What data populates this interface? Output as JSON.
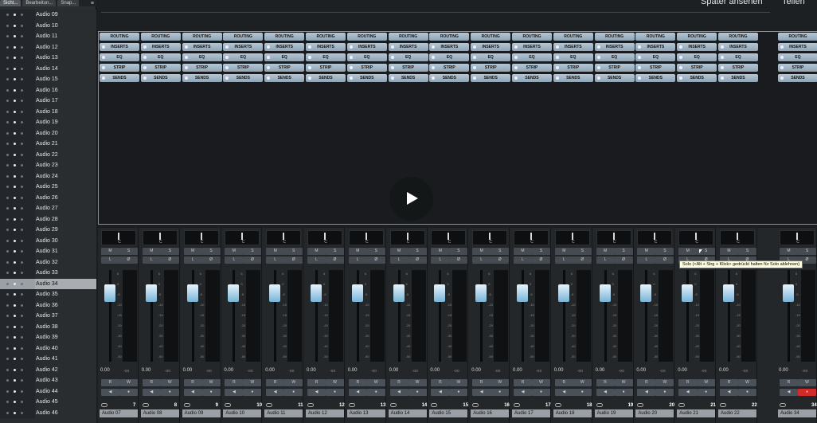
{
  "left_panel": {
    "tabs": [
      "Sicht...",
      "Bearbeitun...",
      "Snap..."
    ],
    "menu_icon": "menu-icon",
    "tracks": [
      "Audio 09",
      "Audio 10",
      "Audio 11",
      "Audio 12",
      "Audio 13",
      "Audio 14",
      "Audio 15",
      "Audio 16",
      "Audio 17",
      "Audio 18",
      "Audio 19",
      "Audio 20",
      "Audio 21",
      "Audio 22",
      "Audio 23",
      "Audio 24",
      "Audio 25",
      "Audio 26",
      "Audio 27",
      "Audio 28",
      "Audio 29",
      "Audio 30",
      "Audio 31",
      "Audio 32",
      "Audio 33",
      "Audio 34",
      "Audio 35",
      "Audio 36",
      "Audio 37",
      "Audio 38",
      "Audio 39",
      "Audio 40",
      "Audio 41",
      "Audio 42",
      "Audio 43",
      "Audio 44",
      "Audio 45",
      "Audio 46"
    ],
    "selected_track": "Audio 34"
  },
  "top_bar": {
    "watch_later": "Später ansehen",
    "share": "Teilen"
  },
  "rack_buttons": [
    "ROUTING",
    "INSERTS",
    "EQ",
    "STRIP",
    "SENDS"
  ],
  "play_icon": "play-icon",
  "strips": [
    {
      "num": "7",
      "name": "Audio 07"
    },
    {
      "num": "8",
      "name": "Audio 08"
    },
    {
      "num": "9",
      "name": "Audio 09"
    },
    {
      "num": "10",
      "name": "Audio 10"
    },
    {
      "num": "11",
      "name": "Audio 11"
    },
    {
      "num": "12",
      "name": "Audio 12"
    },
    {
      "num": "13",
      "name": "Audio 13"
    },
    {
      "num": "14",
      "name": "Audio 14"
    },
    {
      "num": "15",
      "name": "Audio 15"
    },
    {
      "num": "16",
      "name": "Audio 16"
    },
    {
      "num": "17",
      "name": "Audio 17"
    },
    {
      "num": "18",
      "name": "Audio 18"
    },
    {
      "num": "19",
      "name": "Audio 19"
    },
    {
      "num": "20",
      "name": "Audio 20"
    },
    {
      "num": "21",
      "name": "Audio 21"
    },
    {
      "num": "22",
      "name": "Audio 22"
    },
    {
      "num": "34",
      "name": "Audio 34"
    }
  ],
  "strip_controls": {
    "pan": "C",
    "mute": "M",
    "solo": "S",
    "listen": "L",
    "phase": "Ø",
    "read": "R",
    "write": "W",
    "volume": "0.00",
    "peak": "-oo",
    "scale": [
      "6",
      "0",
      "-5",
      "-10",
      "-15",
      "-20",
      "-30",
      "-40",
      "-50"
    ]
  },
  "tooltip": "Solo (<Alt + Strg + Klick> gedrückt halten für Solo ablehnen)"
}
